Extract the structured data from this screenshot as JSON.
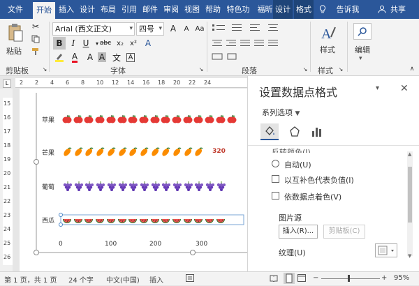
{
  "tabs": [
    "文件",
    "开始",
    "插入",
    "设计",
    "布局",
    "引用",
    "邮件",
    "审阅",
    "视图",
    "帮助",
    "特色功",
    "福昕PI",
    "设计",
    "格式"
  ],
  "tell_me": "告诉我",
  "share": "共享",
  "ribbon": {
    "paste_label": "粘贴",
    "clipboard_group": "剪贴板",
    "font_name": "Arial (西文正文)",
    "font_size": "四号",
    "font_group": "字体",
    "paragraph_group": "段落",
    "styles_label": "样式",
    "styles_group": "样式",
    "editing_label": "编辑",
    "bold": "B",
    "italic": "I",
    "underline": "U",
    "strike": "abc",
    "sub": "x₂",
    "sup": "x²",
    "font_color_a": "A",
    "aa_grow": "A",
    "aa_case": "Aa",
    "char_a": "A",
    "wen": "文",
    "colors": {
      "accent": "#2b579a",
      "font_red": "#e81123",
      "highlight": "#ffeb3b"
    }
  },
  "ruler_h": [
    "2",
    "2",
    "4",
    "6",
    "8",
    "10",
    "12",
    "14",
    "16",
    "18",
    "20",
    "22",
    "24"
  ],
  "ruler_v": [
    "15",
    "16",
    "17",
    "18",
    "19",
    "20",
    "21",
    "22",
    "23",
    "24",
    "25",
    "26"
  ],
  "ruler_corner": "L",
  "chart_data": {
    "type": "bar",
    "orientation": "horizontal",
    "picture_fill": "stacked",
    "categories": [
      "苹果",
      "芒果",
      "葡萄",
      "西瓜"
    ],
    "values": [
      388,
      320,
      380,
      360
    ],
    "data_labels": {
      "芒果": "320"
    },
    "xticks": [
      "0",
      "100",
      "200",
      "300"
    ],
    "icons": [
      "apple-icon",
      "mango-icon",
      "grapes-icon",
      "watermelon-icon"
    ],
    "icon_counts": [
      16,
      13,
      15,
      15
    ],
    "xlim": [
      0,
      400
    ]
  },
  "pane": {
    "title": "设置数据点格式",
    "series_options": "系列选项",
    "partial_option": "反转颜色(I)",
    "auto": "自动(U)",
    "invert_negative": "以互补色代表负值(I)",
    "vary_colors": "依数据点着色(V)",
    "picture_source": "图片源",
    "insert_btn": "插入(R)...",
    "clipboard_btn": "剪贴板(C)",
    "texture": "纹理(U)"
  },
  "status": {
    "page": "第 1 页，共 1 页",
    "words": "24 个字",
    "lang": "中文(中国)",
    "mode": "插入",
    "zoom": "95%",
    "minus": "−",
    "plus": "+"
  }
}
